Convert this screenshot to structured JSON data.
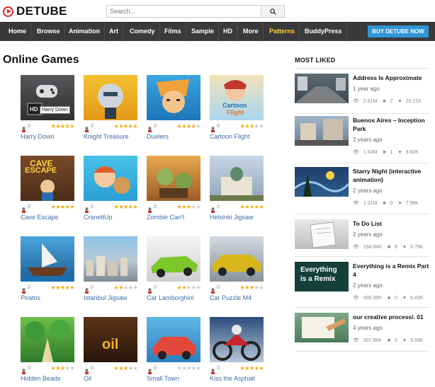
{
  "brand": {
    "name": "DETUBE"
  },
  "search": {
    "placeholder": "Search..."
  },
  "nav": {
    "items": [
      {
        "label": "Home"
      },
      {
        "label": "Browse"
      },
      {
        "label": "Animation"
      },
      {
        "label": "Art"
      },
      {
        "label": "Comedy"
      },
      {
        "label": "Films"
      },
      {
        "label": "Sample"
      },
      {
        "label": "HD"
      },
      {
        "label": "More"
      },
      {
        "label": "Patterns",
        "active": true
      },
      {
        "label": "BuddyPress"
      }
    ],
    "buy_label": "BUY DETUBE NOW"
  },
  "main": {
    "title": "Online Games",
    "tooltip": "Harry Down",
    "games": [
      {
        "title": "Harry Down",
        "plays": "0",
        "rating": 5
      },
      {
        "title": "Knight Treasure",
        "plays": "0",
        "rating": 5
      },
      {
        "title": "Duelers",
        "plays": "0",
        "rating": 4
      },
      {
        "title": "Cartoon Flight",
        "plays": "0",
        "rating": 3
      },
      {
        "title": "Cave Escape",
        "plays": "0",
        "rating": 5
      },
      {
        "title": "CraneltUp",
        "plays": "0",
        "rating": 5
      },
      {
        "title": "Zombie Can't",
        "plays": "0",
        "rating": 3
      },
      {
        "title": "Helsinki Jigsaw",
        "plays": "0",
        "rating": 5
      },
      {
        "title": "Piratos",
        "plays": "0",
        "rating": 5
      },
      {
        "title": "Istanbul Jigsaw",
        "plays": "0",
        "rating": 2
      },
      {
        "title": "Car Lamborghini",
        "plays": "0",
        "rating": 2
      },
      {
        "title": "Car Puzzle M4",
        "plays": "0",
        "rating": 3
      },
      {
        "title": "Hidden Beads",
        "plays": "0",
        "rating": 3
      },
      {
        "title": "Oil",
        "plays": "0",
        "rating": 3
      },
      {
        "title": "Small Town",
        "plays": "0",
        "rating": 0
      },
      {
        "title": "Kiss the Asphalt",
        "plays": "0",
        "rating": 5
      }
    ]
  },
  "sidebar": {
    "title": "MOST LIKED",
    "items": [
      {
        "title": "Address Is Approximate",
        "age": "1 year ago",
        "views": "2.61M",
        "comments": "2",
        "likes": "26.21K"
      },
      {
        "title": "Buenos Aires – Inception Park",
        "age": "2 years ago",
        "views": "1.54M",
        "comments": "1",
        "likes": "9.60K"
      },
      {
        "title": "Starry Night (interactive animation)",
        "age": "2 years ago",
        "views": "1.31M",
        "comments": "0",
        "likes": "7.98K"
      },
      {
        "title": "To Do List",
        "age": "2 years ago",
        "views": "154.94K",
        "comments": "6",
        "likes": "6.79K"
      },
      {
        "title": "Everything is a Remix Part 4",
        "age": "2 years ago",
        "views": "400.39K",
        "comments": "0",
        "likes": "6.43K"
      },
      {
        "title": "our creative process/. 01",
        "age": "4 years ago",
        "views": "307.86K",
        "comments": "0",
        "likes": "5.55K"
      }
    ],
    "thumb_texts": {
      "remix_line1": "Everything",
      "remix_line2": "is a Remix"
    }
  },
  "thumb_texts": {
    "cave": "CAVE",
    "escape": "ESCAPE",
    "oil": "oil",
    "cartoon": "Cartoon",
    "flight": "Flight",
    "hd": "HD"
  }
}
